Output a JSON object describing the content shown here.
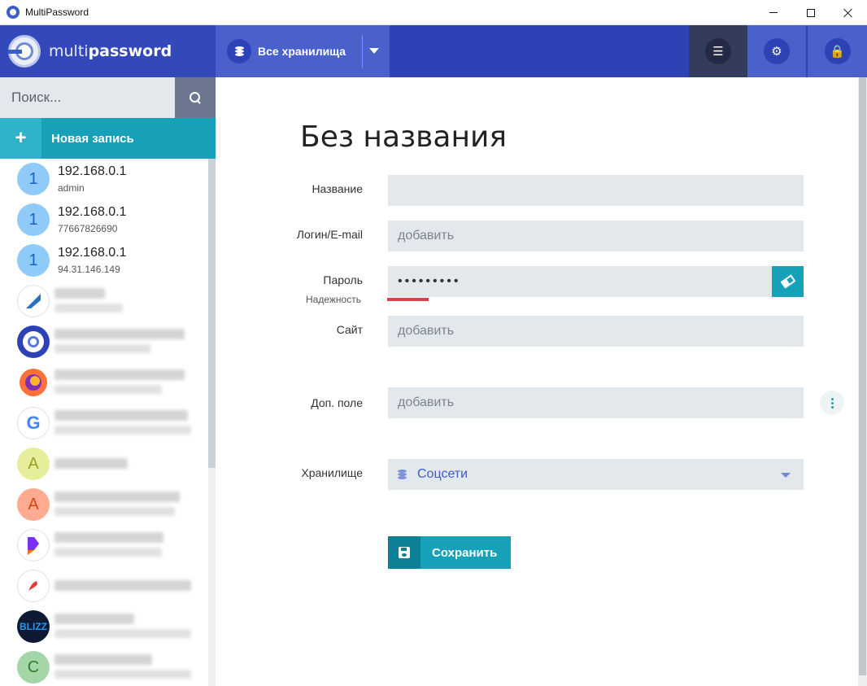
{
  "window": {
    "title": "MultiPassword"
  },
  "brand": {
    "name_light": "multi",
    "name_bold": "password"
  },
  "header": {
    "vault_selector_label": "Все хранилища",
    "icons": [
      "list-icon",
      "gear-icon",
      "lock-icon"
    ]
  },
  "sidebar": {
    "search_placeholder": "Поиск...",
    "new_entry_label": "Новая запись",
    "new_entry_icon": "+",
    "entries": [
      {
        "avatar": "1",
        "title": "192.168.0.1",
        "subtitle": "admin"
      },
      {
        "avatar": "1",
        "title": "192.168.0.1",
        "subtitle": "77667826690"
      },
      {
        "avatar": "1",
        "title": "192.168.0.1",
        "subtitle": "94.31.146.149"
      },
      {
        "avatar": "",
        "title": "",
        "subtitle": ""
      },
      {
        "avatar": "",
        "title": "",
        "subtitle": ""
      },
      {
        "avatar": "",
        "title": "",
        "subtitle": ""
      },
      {
        "avatar": "G",
        "title": "",
        "subtitle": ""
      },
      {
        "avatar": "A",
        "title": "",
        "subtitle": ""
      },
      {
        "avatar": "A",
        "title": "",
        "subtitle": ""
      },
      {
        "avatar": "",
        "title": "",
        "subtitle": ""
      },
      {
        "avatar": "",
        "title": "",
        "subtitle": ""
      },
      {
        "avatar": "",
        "title": "",
        "subtitle": ""
      },
      {
        "avatar": "C",
        "title": "",
        "subtitle": ""
      }
    ]
  },
  "form": {
    "heading": "Без названия",
    "name_label": "Название",
    "name_value": "",
    "login_label": "Логин/E-mail",
    "login_placeholder": "добавить",
    "password_label": "Пароль",
    "password_value": "•••••••••",
    "strength_label": "Надежность",
    "strength_level": 0.1,
    "site_label": "Сайт",
    "site_placeholder": "добавить",
    "extra_label": "Доп. поле",
    "extra_placeholder": "добавить",
    "vault_label": "Хранилище",
    "vault_value": "Соцсети",
    "save_label": "Сохранить"
  },
  "colors": {
    "header": "#2d43b5",
    "accent": "#16a1b8",
    "danger": "#d9434e",
    "field_bg": "#e3e8ec"
  }
}
